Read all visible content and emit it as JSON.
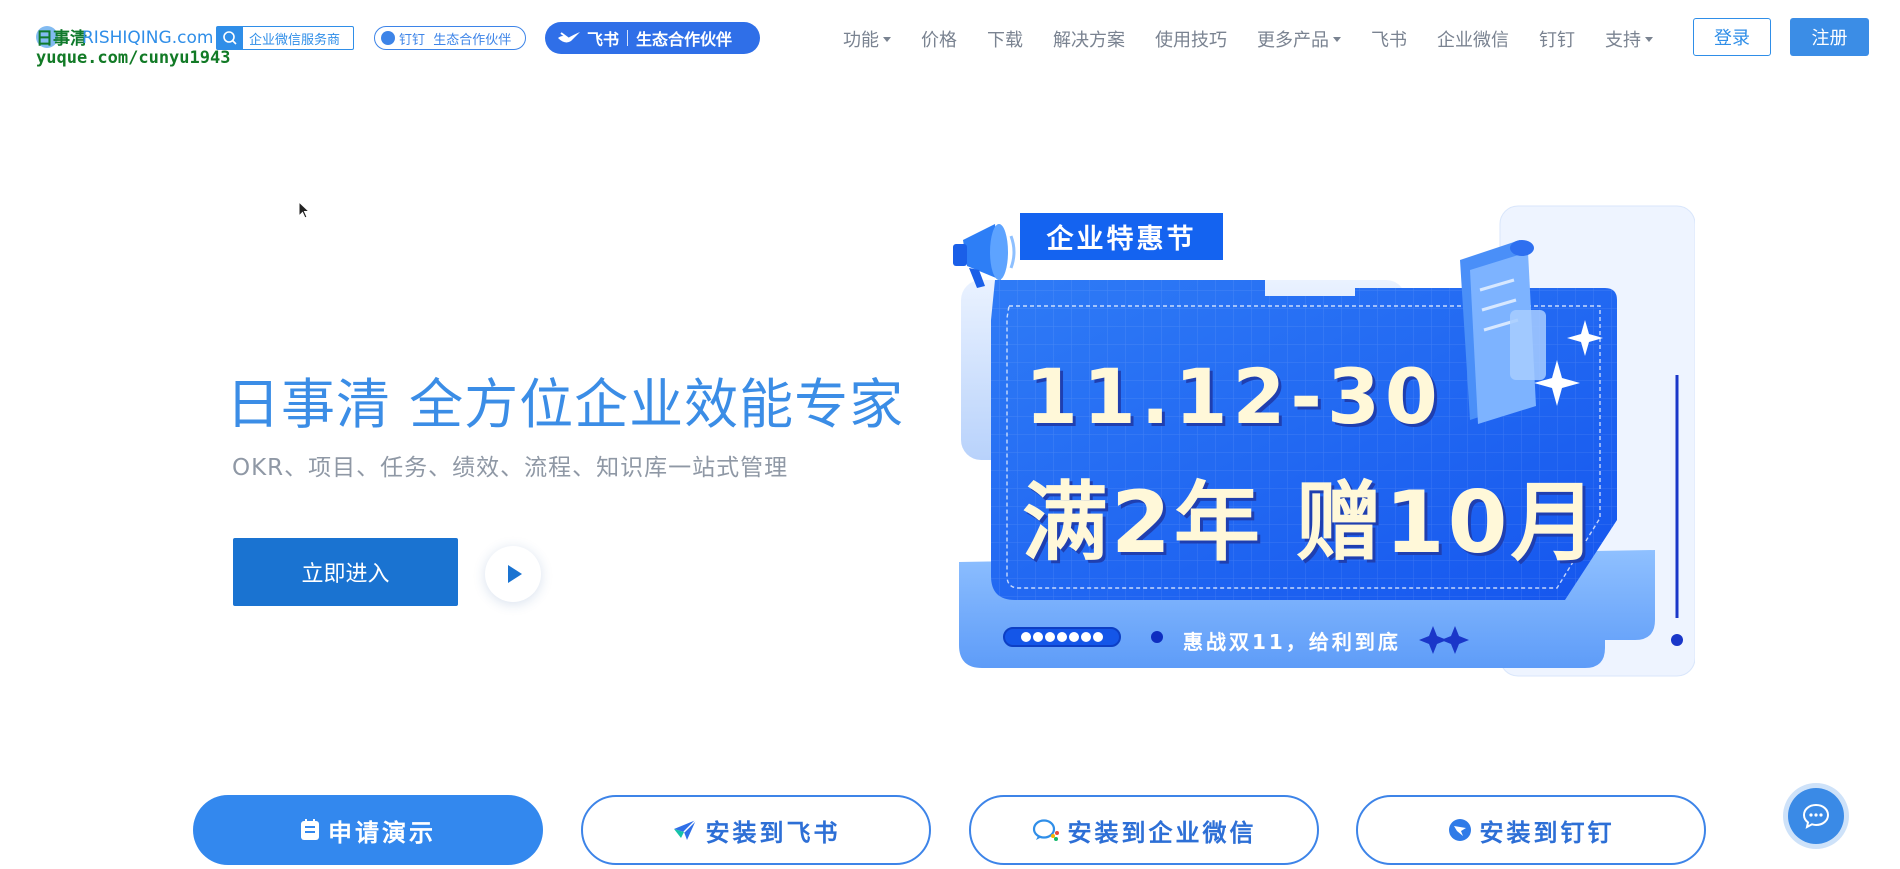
{
  "header": {
    "logo": {
      "name_cn": "日事清",
      "domain": "RISHIQING.com"
    },
    "watermark": "yuque.com/cunyu1943",
    "partner_badges": {
      "wecom": "企业微信服务商",
      "dingtalk": "钉钉  生态合作伙伴",
      "feishu_brand": "飞书",
      "feishu_label": "生态合作伙伴"
    },
    "nav": [
      {
        "label": "功能",
        "dropdown": true
      },
      {
        "label": "价格",
        "dropdown": false
      },
      {
        "label": "下载",
        "dropdown": false
      },
      {
        "label": "解决方案",
        "dropdown": false
      },
      {
        "label": "使用技巧",
        "dropdown": false
      },
      {
        "label": "更多产品",
        "dropdown": true
      },
      {
        "label": "飞书",
        "dropdown": false
      },
      {
        "label": "企业微信",
        "dropdown": false
      },
      {
        "label": "钉钉",
        "dropdown": false
      },
      {
        "label": "支持",
        "dropdown": true
      }
    ],
    "login_label": "登录",
    "register_label": "注册"
  },
  "hero": {
    "title": "日事清 全方位企业效能专家",
    "subtitle": "OKR、项目、任务、绩效、流程、知识库一站式管理",
    "enter_label": "立即进入"
  },
  "promo": {
    "ribbon": "企业特惠节",
    "date": "11.12-30",
    "headline": "满2年 赠10月",
    "tagline": "惠战双11，给利到底"
  },
  "cta": {
    "demo": "申请演示",
    "feishu": "安装到飞书",
    "wecom": "安装到企业微信",
    "dingtalk": "安装到钉钉"
  },
  "colors": {
    "brand": "#3b8de6",
    "primary_button": "#1a73d1",
    "promo_blue": "#1463f0",
    "promo_text": "#fff8d9"
  }
}
